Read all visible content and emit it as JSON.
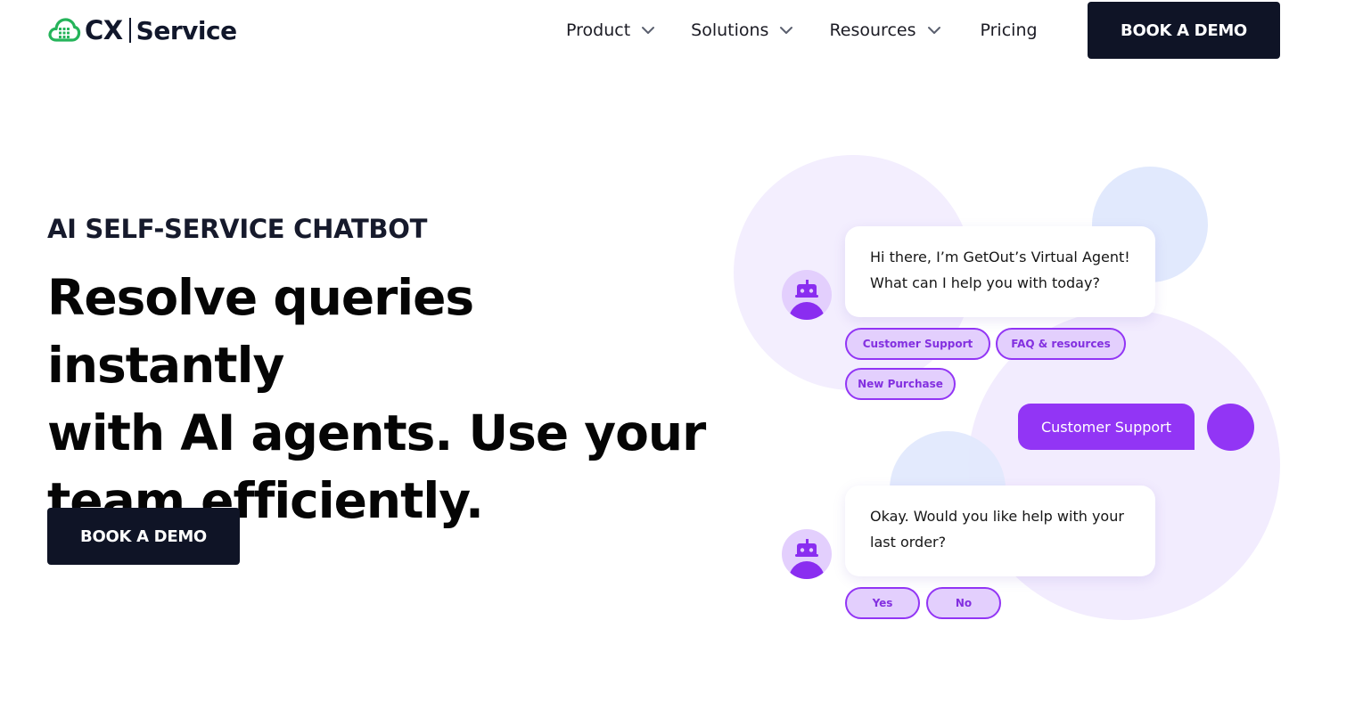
{
  "brand": {
    "logo_mark": "CX",
    "logo_name": "Service",
    "colors": {
      "dark": "#0f1426",
      "accent": "#9235f5",
      "logo_green": "#25b45a",
      "chip_bg": "#e3cffd"
    }
  },
  "nav": {
    "items": [
      {
        "label": "Product",
        "icon": "chevron-down-icon"
      },
      {
        "label": "Solutions",
        "icon": "chevron-down-icon"
      },
      {
        "label": "Resources",
        "icon": "chevron-down-icon"
      },
      {
        "label": "Pricing"
      }
    ],
    "cta_label": "BOOK A DEMO"
  },
  "hero": {
    "eyebrow": "AI SELF-SERVICE CHATBOT",
    "headline_lines": [
      "Resolve queries instantly",
      "with AI agents. Use your",
      "team efficiently."
    ],
    "cta_label": "BOOK A DEMO"
  },
  "chat": {
    "bot_message_1": [
      "Hi there, I’m GetOut’s Virtual Agent!",
      "What can I help you with today?"
    ],
    "options_1": [
      "Customer Support",
      "FAQ & resources",
      "New Purchase"
    ],
    "user_reply": "Customer Support",
    "bot_message_2": [
      "Okay. Would you like help with your",
      "last order?"
    ],
    "options_2": [
      "Yes",
      "No"
    ],
    "bot_icon": "robot-icon"
  }
}
